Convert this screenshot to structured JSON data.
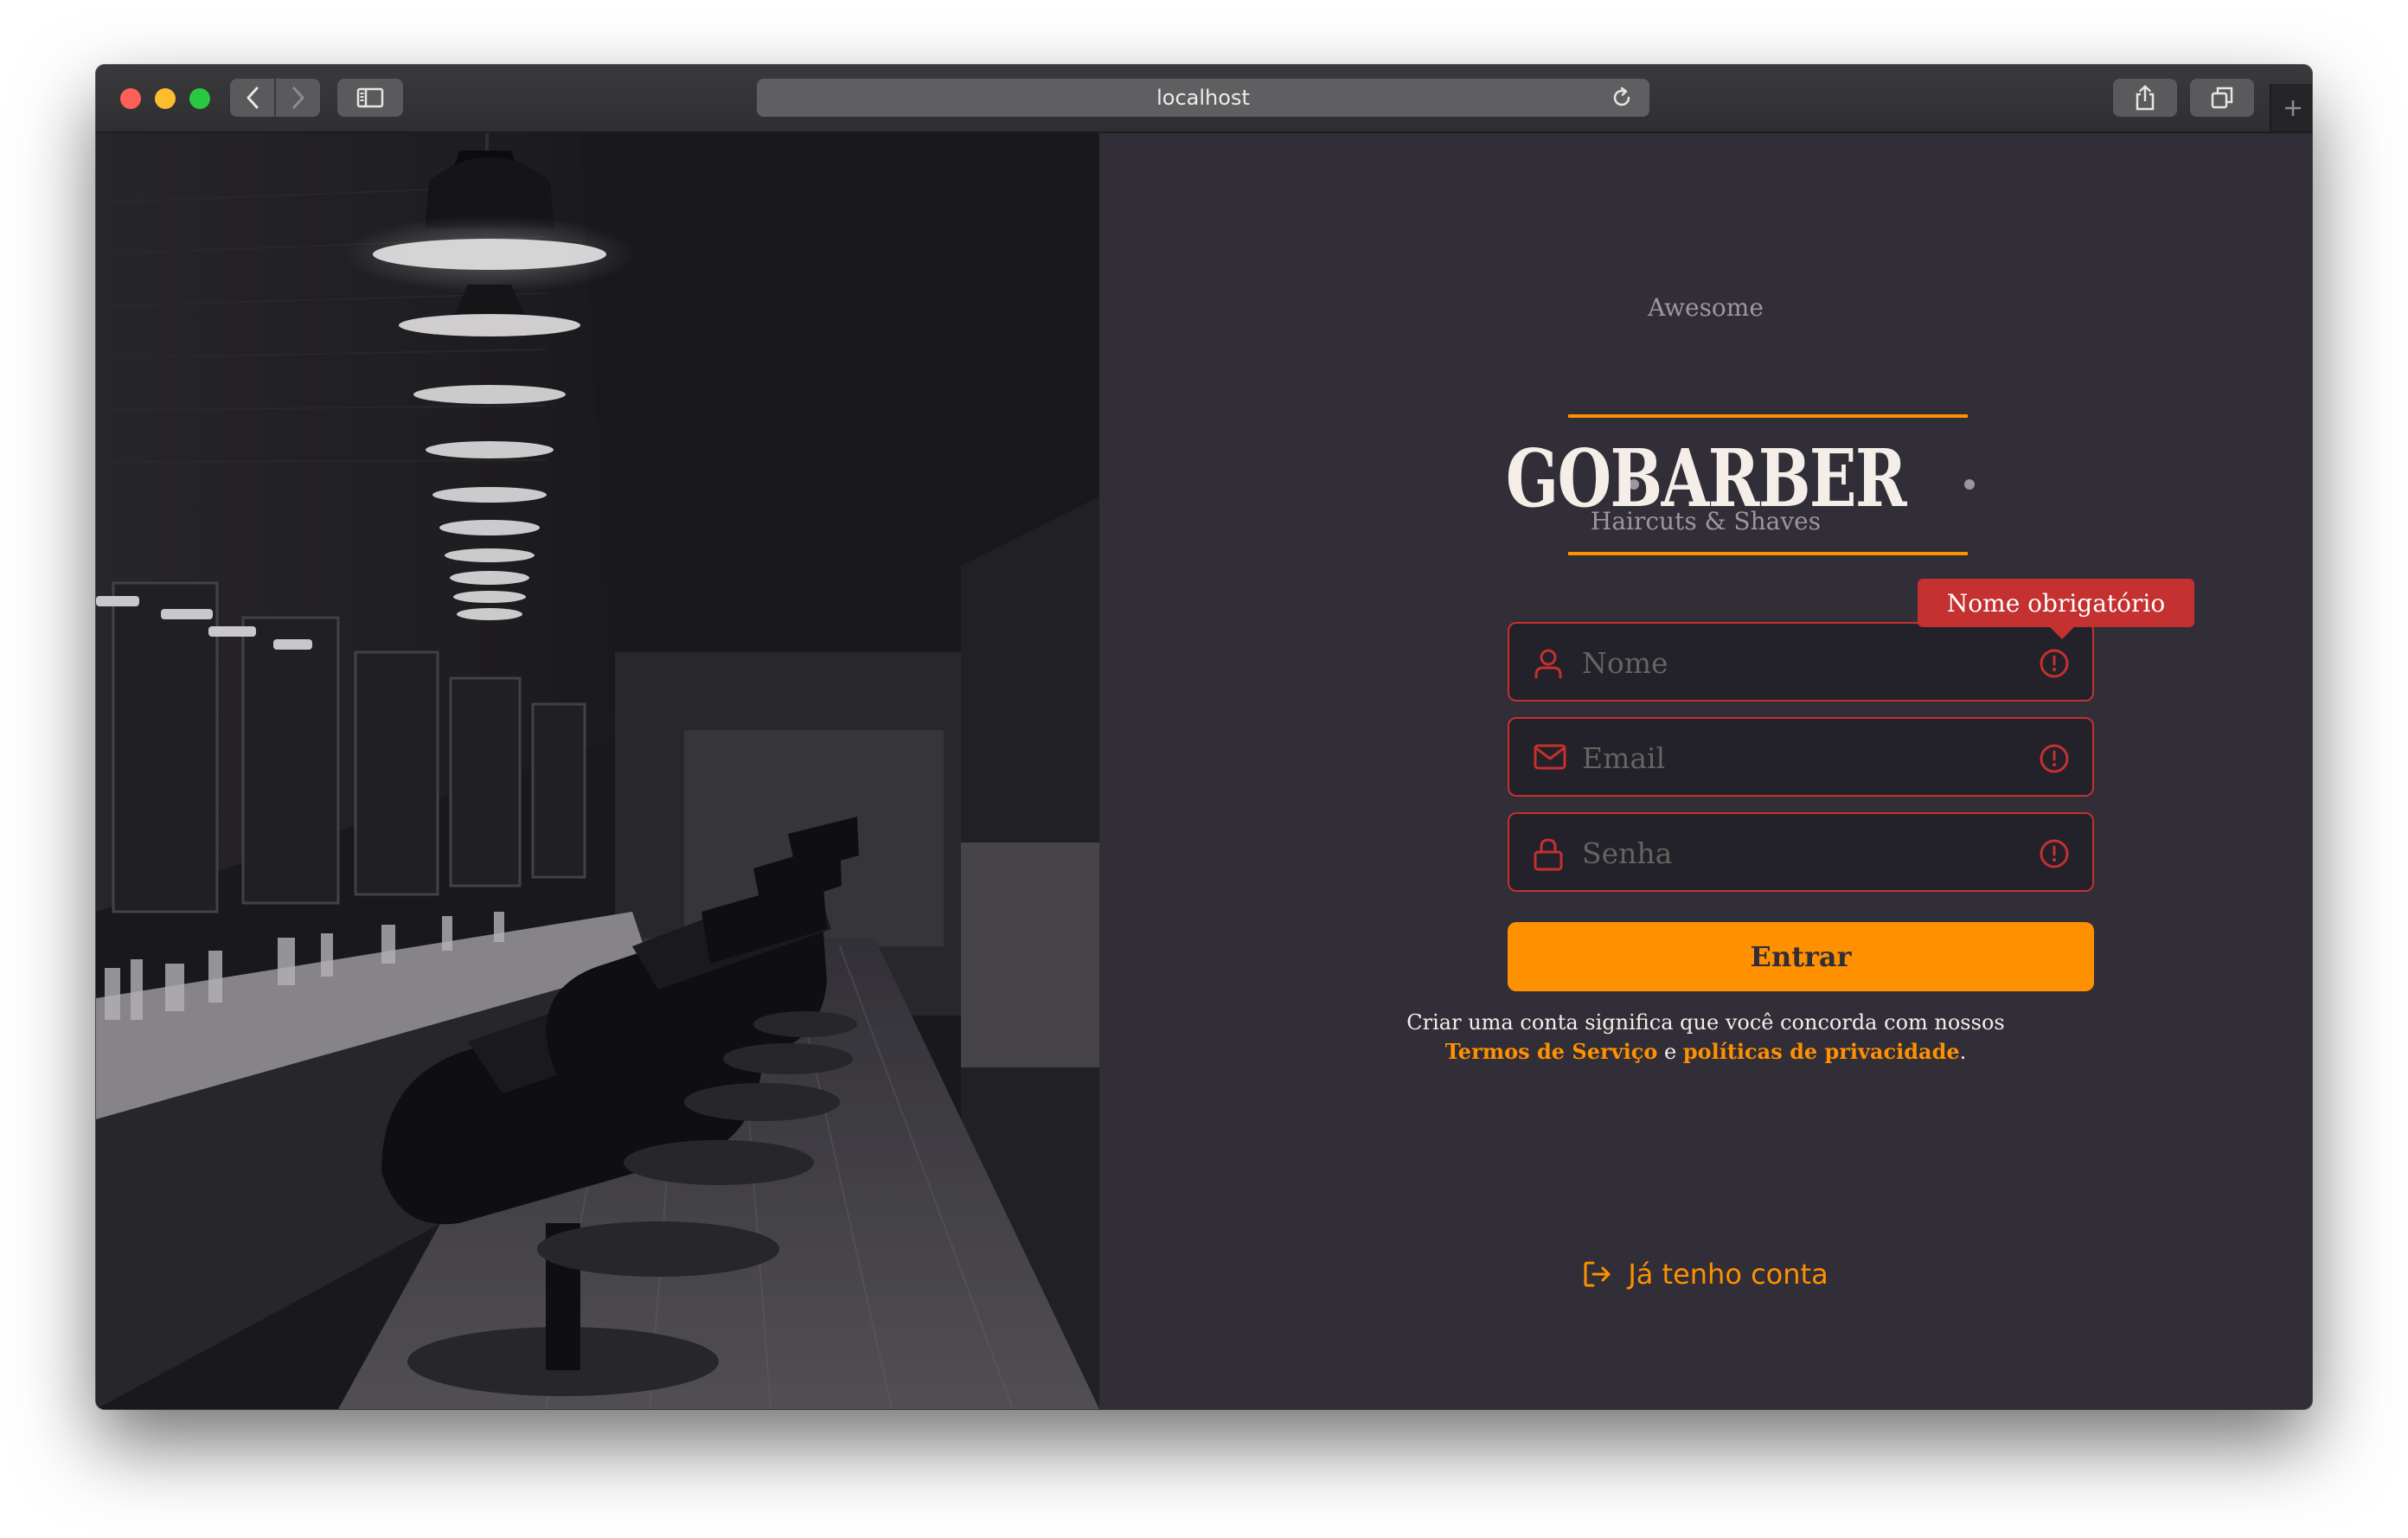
{
  "browser": {
    "url": "localhost"
  },
  "logo": {
    "top_text": "Awesome",
    "main_text": "GOBARBER",
    "bottom_text": "Haircuts & Shaves"
  },
  "form": {
    "name_placeholder": "Nome",
    "email_placeholder": "Email",
    "password_placeholder": "Senha",
    "error_tooltip": "Nome obrigatório",
    "submit_label": "Entrar"
  },
  "terms": {
    "prefix": "Criar uma conta significa que você concorda com nossos",
    "terms_link": "Termos de Serviço",
    "joiner": "e",
    "privacy_link": "políticas de privacidade",
    "suffix": "."
  },
  "login_link": {
    "label": "Já tenho conta"
  },
  "colors": {
    "background": "#312e38",
    "accent": "#ff9000",
    "error": "#c53030",
    "input_bg": "#232129",
    "text": "#f4ede8",
    "muted": "#666360"
  },
  "icons": {
    "name_field": "user-icon",
    "email_field": "mail-icon",
    "password_field": "lock-icon",
    "error": "alert-circle-icon",
    "login": "log-in-icon"
  }
}
